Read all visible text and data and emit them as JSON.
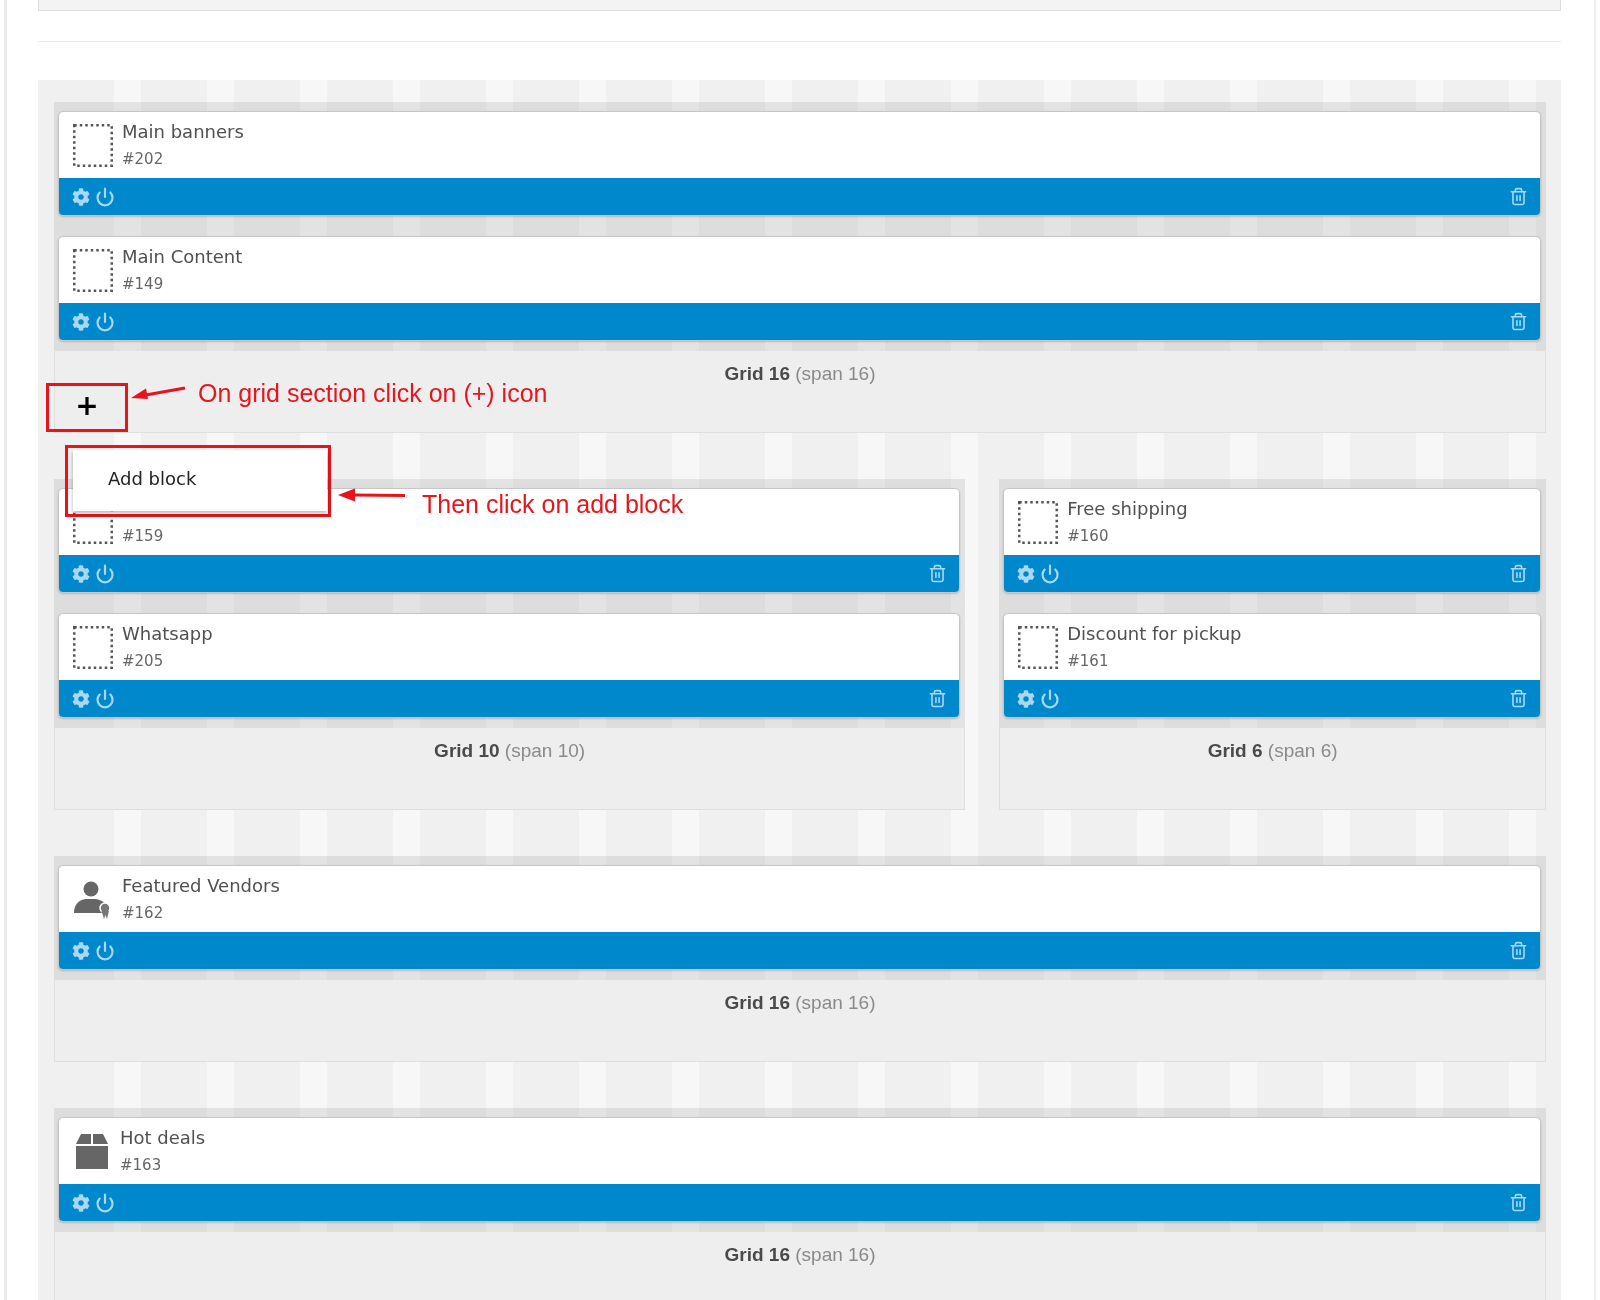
{
  "rows": [
    {
      "sections": [
        {
          "label": "**Grid 16** (span 16)",
          "blocks": [
            {
              "kind": "placeholder",
              "title": "Main banners",
              "id": "#202"
            },
            {
              "kind": "placeholder",
              "title": "Main Content",
              "id": "#149"
            }
          ]
        }
      ],
      "add_button": {
        "label": "+",
        "note": "On grid section click on (+) icon"
      },
      "menu": {
        "items": [
          {
            "label": "Add block"
          }
        ],
        "note": "Then click on add block"
      }
    },
    {
      "sections": [
        {
          "label": "**Grid 10** (span 10)",
          "blocks": [
            {
              "kind": "placeholder",
              "id": "#159"
            },
            {
              "kind": "placeholder",
              "title": "Whatsapp",
              "id": "#205"
            }
          ]
        },
        {
          "label": "**Grid 6** (span 6)",
          "blocks": [
            {
              "kind": "placeholder",
              "title": "Free shipping",
              "id": "#160"
            },
            {
              "kind": "placeholder",
              "title": "Discount for pickup",
              "id": "#161"
            }
          ]
        }
      ]
    },
    {
      "sections": [
        {
          "label": "**Grid 16** (span 16)",
          "blocks": [
            {
              "kind": "vendor",
              "title": "Featured Vendors",
              "id": "#162"
            }
          ]
        }
      ]
    },
    {
      "sections": [
        {
          "label": "**Grid 16** (span 16)",
          "blocks": [
            {
              "kind": "box",
              "title": "Hot deals",
              "id": "#163"
            }
          ]
        }
      ]
    }
  ]
}
